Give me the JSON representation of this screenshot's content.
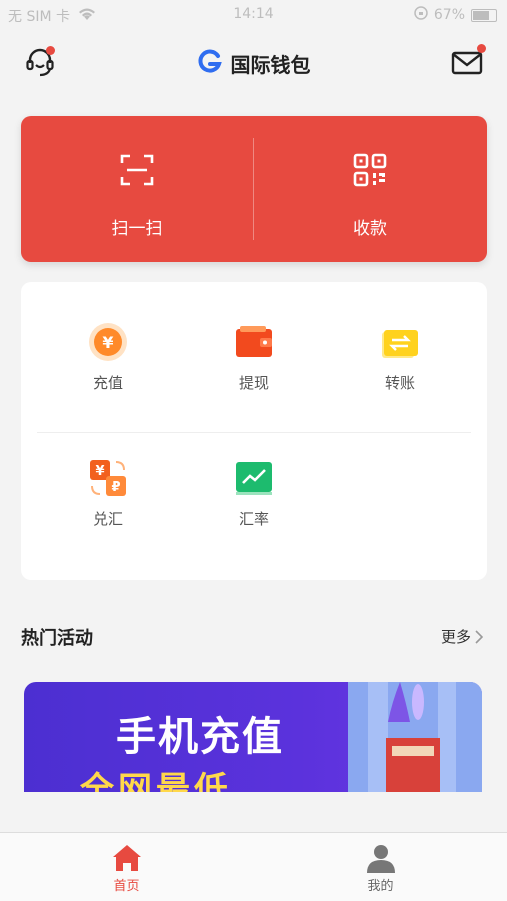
{
  "status_bar": {
    "carrier": "无 SIM 卡",
    "time": "14:14",
    "battery": "67%"
  },
  "header": {
    "title": "国际钱包",
    "logo_letter": "G"
  },
  "scan_card": {
    "scan_label": "扫一扫",
    "receive_label": "收款"
  },
  "services": [
    {
      "label": "充值",
      "icon": "recharge-coin-icon"
    },
    {
      "label": "提现",
      "icon": "wallet-icon"
    },
    {
      "label": "转账",
      "icon": "transfer-icon"
    },
    {
      "label": "兑汇",
      "icon": "exchange-icon"
    },
    {
      "label": "汇率",
      "icon": "rate-chart-icon"
    }
  ],
  "section": {
    "title": "热门活动",
    "more_label": "更多"
  },
  "banner": {
    "headline": "手机充值",
    "subline": "全网最低"
  },
  "tabbar": {
    "home_label": "首页",
    "mine_label": "我的"
  },
  "colors": {
    "primary": "#e74a40",
    "banner": "#5b32dc",
    "active_tab": "#e74a40",
    "inactive_tab": "#666666"
  }
}
